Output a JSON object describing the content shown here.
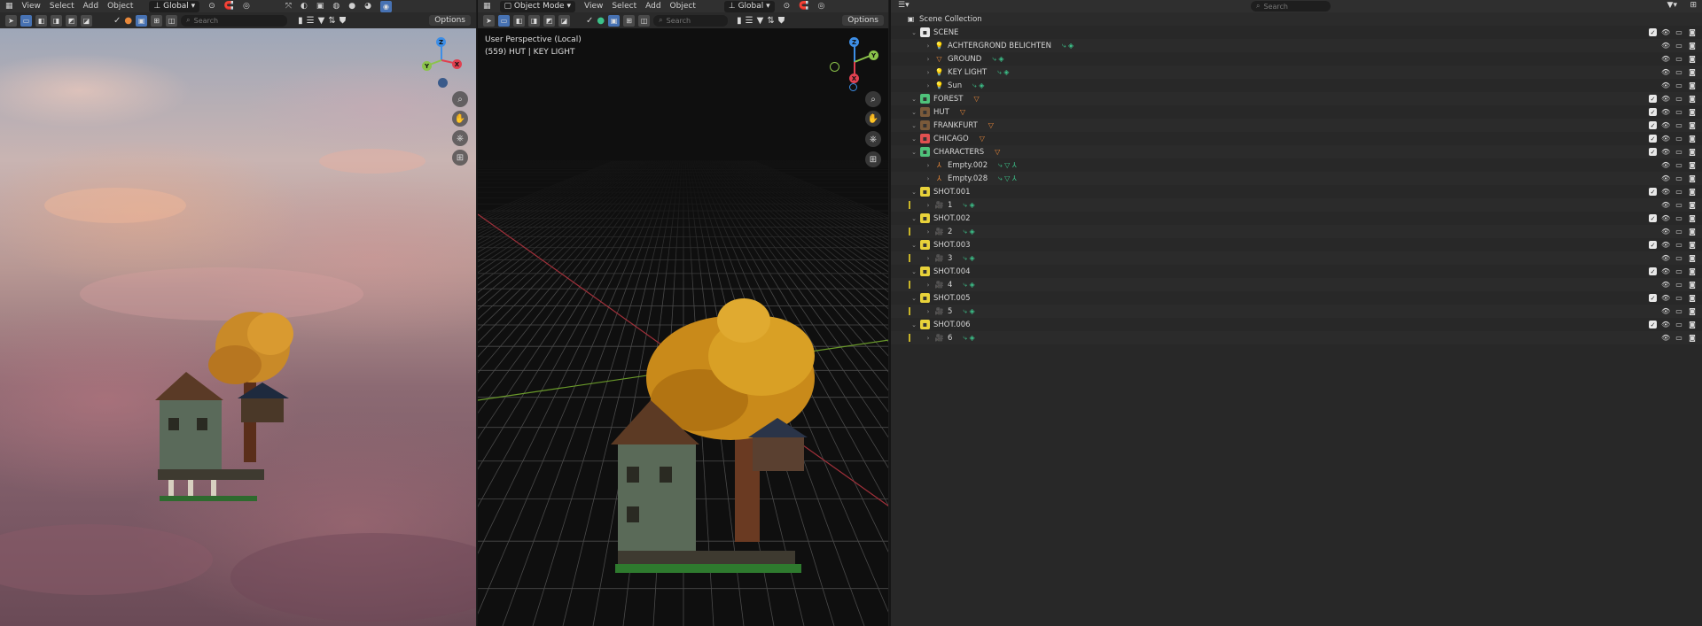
{
  "viewport_left": {
    "menu": [
      "View",
      "Select",
      "Add",
      "Object"
    ],
    "transform_orientation": "Global",
    "search_placeholder": "Search",
    "options_label": "Options"
  },
  "viewport_right": {
    "mode": "Object Mode",
    "menu": [
      "View",
      "Select",
      "Add",
      "Object"
    ],
    "transform_orientation": "Global",
    "search_placeholder": "Search",
    "options_label": "Options",
    "info_line1": "User Perspective (Local)",
    "info_line2": "(559) HUT | KEY LIGHT"
  },
  "gizmo_axes": {
    "x": "X",
    "y": "Y",
    "z": "Z"
  },
  "outliner": {
    "search_placeholder": "Search",
    "root": "Scene Collection",
    "rows": [
      {
        "label": "SCENE",
        "type": "collection"
      },
      {
        "label": "ACHTERGROND BELICHTEN",
        "type": "light"
      },
      {
        "label": "GROUND",
        "type": "mesh"
      },
      {
        "label": "KEY LIGHT",
        "type": "light"
      },
      {
        "label": "Sun",
        "type": "light"
      },
      {
        "label": "FOREST",
        "type": "collection"
      },
      {
        "label": "HUT",
        "type": "collection"
      },
      {
        "label": "FRANKFURT",
        "type": "collection"
      },
      {
        "label": "CHICAGO",
        "type": "collection"
      },
      {
        "label": "CHARACTERS",
        "type": "collection"
      },
      {
        "label": "Empty.002",
        "type": "empty"
      },
      {
        "label": "Empty.028",
        "type": "empty"
      },
      {
        "label": "SHOT.001",
        "type": "collection"
      },
      {
        "label": "1",
        "type": "camera"
      },
      {
        "label": "SHOT.002",
        "type": "collection"
      },
      {
        "label": "2",
        "type": "camera"
      },
      {
        "label": "SHOT.003",
        "type": "collection"
      },
      {
        "label": "3",
        "type": "camera"
      },
      {
        "label": "SHOT.004",
        "type": "collection"
      },
      {
        "label": "4",
        "type": "camera"
      },
      {
        "label": "SHOT.005",
        "type": "collection"
      },
      {
        "label": "5",
        "type": "camera"
      },
      {
        "label": "SHOT.006",
        "type": "collection"
      },
      {
        "label": "6",
        "type": "camera"
      }
    ]
  },
  "colors": {
    "accent": "#4772b3",
    "x_axis": "#e04050",
    "y_axis": "#8bc34a",
    "z_axis": "#3d8ee6",
    "orange": "#e8883a",
    "teal": "#3cc28a"
  }
}
